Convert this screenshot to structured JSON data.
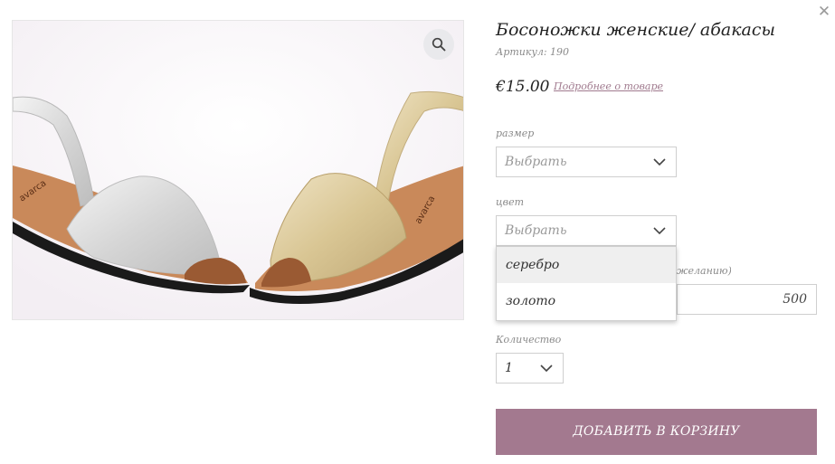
{
  "product": {
    "title": "Босоножки женские/ абакасы",
    "sku": "Артикул: 190",
    "price": "€15.00",
    "details_link": "Подробнее о товаре"
  },
  "image": {
    "brand_label_left": "avarca",
    "brand_label_right": "avarca"
  },
  "options": {
    "size": {
      "label": "размер",
      "placeholder": "Выбрать"
    },
    "color": {
      "label": "цвет",
      "placeholder": "Выбрать",
      "dropdown_open": true,
      "options": [
        "серебро",
        "золото"
      ],
      "hovered_option": "серебро"
    },
    "amount": {
      "label_partial": "желанию)",
      "value": "500"
    },
    "quantity": {
      "label": "Количество",
      "value": "1"
    }
  },
  "actions": {
    "add_to_cart": "ДОБАВИТЬ В КОРЗИНУ"
  },
  "colors": {
    "accent": "#a3798f",
    "link": "#a07a8e",
    "hover_bg": "#efefef"
  },
  "icons": {
    "close": "close-icon",
    "zoom": "search-icon",
    "chevron": "chevron-down-icon"
  }
}
